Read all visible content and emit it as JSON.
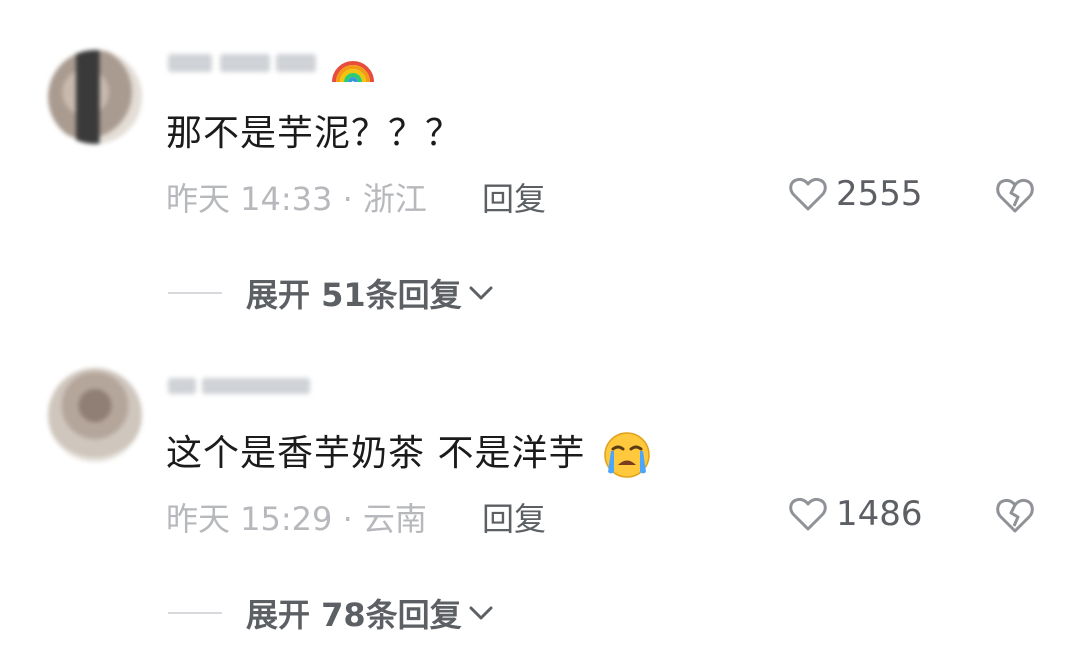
{
  "comments": [
    {
      "content": "那不是芋泥？？？",
      "meta": "昨天 14:33 · 浙江",
      "reply_label": "回复",
      "like_count": "2555",
      "expand_label": "展开 51条回复",
      "badge_icon": "rainbow-icon"
    },
    {
      "content": "这个是香芋奶茶 不是洋芋",
      "content_emoji": "loudly-crying-face-icon",
      "meta": "昨天 15:29 · 云南",
      "reply_label": "回复",
      "like_count": "1486",
      "expand_label": "展开 78条回复"
    }
  ],
  "colors": {
    "text_primary": "#1b1b1b",
    "text_secondary": "#b6b8bc",
    "text_action": "#5c5f63",
    "divider": "#d7d9dc"
  }
}
